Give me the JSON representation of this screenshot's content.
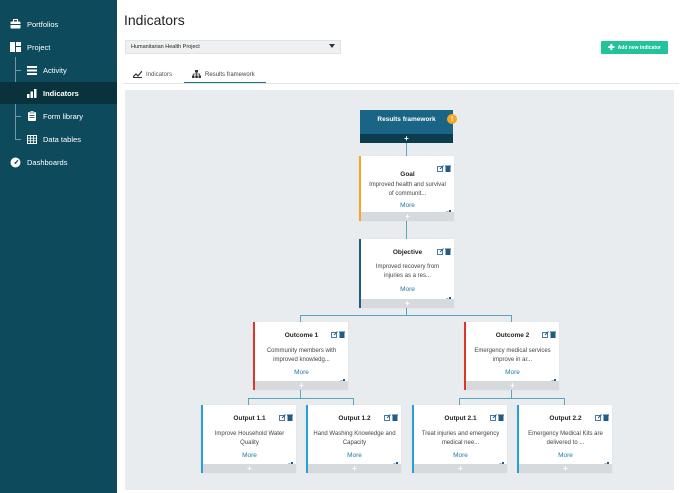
{
  "sidebar": {
    "items": [
      {
        "label": "Portfolios",
        "icon": "briefcase-icon"
      },
      {
        "label": "Project",
        "icon": "project-icon"
      },
      {
        "label": "Activity",
        "icon": "list-icon"
      },
      {
        "label": "Indicators",
        "icon": "bar-chart-icon"
      },
      {
        "label": "Form library",
        "icon": "clipboard-icon"
      },
      {
        "label": "Data tables",
        "icon": "table-icon"
      },
      {
        "label": "Dashboards",
        "icon": "gauge-icon"
      }
    ],
    "active": "Indicators"
  },
  "header": {
    "title": "Indicators",
    "project_select": "Humanitarian Health Project",
    "add_button": "Add new indicator"
  },
  "tabs": [
    {
      "label": "Indicators",
      "icon": "indicators-icon",
      "active": false
    },
    {
      "label": "Results framework",
      "icon": "hierarchy-icon",
      "active": true
    }
  ],
  "framework": {
    "root": {
      "title": "Results framework",
      "warning": "!",
      "add": "+"
    },
    "goal": {
      "title": "Goal",
      "desc": "Improved health and survival of communit...",
      "more": "More",
      "add": "+"
    },
    "objective": {
      "title": "Objective",
      "desc": "Improved recovery from injuries as a res...",
      "more": "More",
      "add": "+"
    },
    "outcomes": [
      {
        "title": "Outcome 1",
        "desc": "Community members with improved knowledg...",
        "more": "More",
        "add": "+"
      },
      {
        "title": "Outcome 2",
        "desc": "Emergency medical services improve in ar...",
        "more": "More",
        "add": "+"
      }
    ],
    "outputs": [
      {
        "title": "Output 1.1",
        "desc": "Improve Household Water Quality",
        "more": "More",
        "add": "+"
      },
      {
        "title": "Output 1.2",
        "desc": "Hand Washing Knowledge and Capacity",
        "more": "More",
        "add": "+"
      },
      {
        "title": "Output 2.1",
        "desc": "Treat injuries and emergency medical nee...",
        "more": "More",
        "add": "+"
      },
      {
        "title": "Output 2.2",
        "desc": "Emergency Medical Kits are delivered to ...",
        "more": "More",
        "add": "+"
      }
    ]
  },
  "colors": {
    "sidebar": "#0d4b5c",
    "accent": "#1a6585",
    "add_button": "#22c39b",
    "goal": "#f5a623",
    "outcome": "#d9362c",
    "output": "#2a9fd6"
  }
}
